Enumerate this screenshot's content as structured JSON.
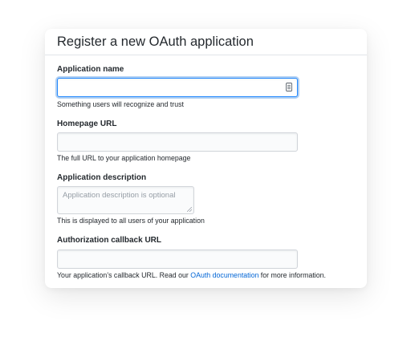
{
  "dialog": {
    "title": "Register a new OAuth application"
  },
  "fields": {
    "app_name": {
      "label": "Application name",
      "value": "",
      "note": "Something users will recognize and trust"
    },
    "homepage_url": {
      "label": "Homepage URL",
      "value": "",
      "note": "The full URL to your application homepage"
    },
    "description": {
      "label": "Application description",
      "placeholder": "Application description is optional",
      "note": "This is displayed to all users of your application"
    },
    "callback_url": {
      "label": "Authorization callback URL",
      "value": "",
      "note_prefix": "Your application’s callback URL. Read our ",
      "note_link": "OAuth documentation",
      "note_suffix": " for more information."
    }
  },
  "icons": {
    "autofill": "contact-card-icon"
  },
  "colors": {
    "focus_border": "#2188ff",
    "link": "#0366d6",
    "text": "#24292e",
    "placeholder": "#959da5",
    "input_bg": "#fafbfc"
  }
}
